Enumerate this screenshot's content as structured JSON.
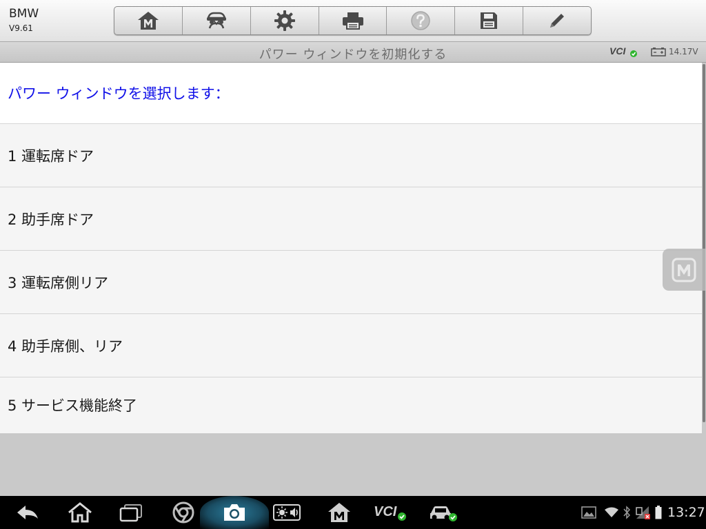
{
  "header": {
    "brand": "BMW",
    "version": "V9.61",
    "toolbar": [
      {
        "icon": "home-m-icon"
      },
      {
        "icon": "vehicle-swap-icon"
      },
      {
        "icon": "gear-icon"
      },
      {
        "icon": "printer-icon"
      },
      {
        "icon": "help-icon"
      },
      {
        "icon": "save-icon"
      },
      {
        "icon": "pencil-icon"
      }
    ]
  },
  "titlebar": {
    "title": "パワー ウィンドウを初期化する",
    "vci_label": "VCI",
    "voltage": "14.17V"
  },
  "content": {
    "prompt": "パワー ウィンドウを選択します：",
    "items": [
      "1 運転席ドア",
      "2 助手席ドア",
      "3 運転席側リア",
      "4 助手席側、リア",
      "5 サービス機能終了"
    ]
  },
  "navbar": {
    "vci_label": "VCI",
    "time": "13:27"
  },
  "colors": {
    "prompt_text": "#1010e8",
    "status_ok": "#2fb52f",
    "nav_bg": "#000000"
  }
}
